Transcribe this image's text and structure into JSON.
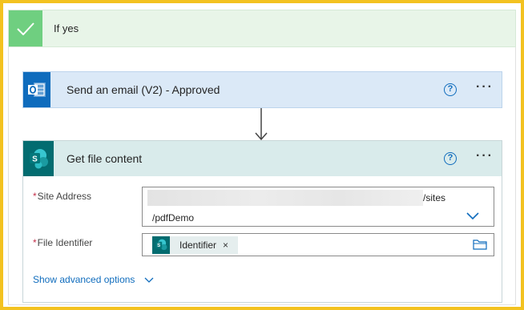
{
  "condition": {
    "title": "If yes"
  },
  "email_action": {
    "title": "Send an email (V2) - Approved",
    "help": "?",
    "more": "···"
  },
  "file_action": {
    "title": "Get file content",
    "help": "?",
    "more": "···",
    "site_address": {
      "required_mark": "*",
      "label": "Site Address",
      "value_line1_suffix": "/sites",
      "value_line2": "/pdfDemo"
    },
    "file_identifier": {
      "required_mark": "*",
      "label": "File Identifier",
      "token_label": "Identifier",
      "token_remove": "×"
    },
    "advanced_link": "Show advanced options"
  },
  "colors": {
    "frame": "#f3c220",
    "condition_bg": "#e8f5e8",
    "check": "#6fcf80",
    "email_bg": "#dbe9f7",
    "outlook": "#0f6cbd",
    "sharepoint": "#036c70",
    "sharepoint_bg": "#d9ebeb",
    "link": "#0f6cbd",
    "required": "#c4314b"
  },
  "icons": {
    "condition": "check-icon",
    "email": "outlook-icon",
    "file": "sharepoint-icon",
    "help": "help-icon",
    "more": "more-options-icon",
    "dropdown": "chevron-down-icon",
    "folder": "folder-icon"
  }
}
